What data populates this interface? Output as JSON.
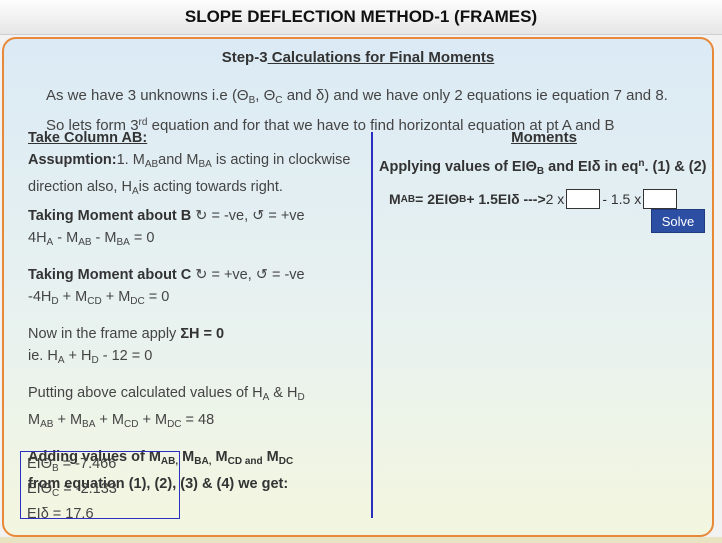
{
  "header": {
    "title": "SLOPE DEFLECTION METHOD-1 (FRAMES)"
  },
  "step": {
    "prefix": "Step-3",
    "title": " Calculations for Final Moments"
  },
  "intro": {
    "l1a": "As we have 3 unknowns i.e (Θ",
    "l1b": "B",
    "l1c": ", Θ",
    "l1d": "C",
    "l1e": " and δ) and we have only 2 equations ie equation 7 and 8.",
    "l2a": "So lets form 3",
    "l2b": "rd",
    "l2c": " equation and for that we have to find horizontal equation at pt A and B"
  },
  "left": {
    "column_title": "Take Column AB:",
    "assump_label": "Assupmtion:",
    "assump_a": "1. M",
    "assump_b": "AB",
    "assump_c": "and M",
    "assump_d": "BA",
    "assump_e": " is acting in clockwise",
    "assump2_a": "direction also, H",
    "assump2_b": "A",
    "assump2_c": "is acting towards right.",
    "tmB_label": "Taking Moment about B",
    "tmB_signs": " ↻ = -ve, ↺ = +ve",
    "eqB_a": "4H",
    "eqB_b": "A",
    "eqB_c": " - M",
    "eqB_d": "AB",
    "eqB_e": " - M",
    "eqB_f": "BA",
    "eqB_g": " = 0",
    "tmC_label": "Taking Moment about C",
    "tmC_signs": " ↻ = +ve, ↺ = -ve",
    "eqC_a": "-4H",
    "eqC_b": "D",
    "eqC_c": " + M",
    "eqC_d": "CD",
    "eqC_e": " + M",
    "eqC_f": "DC",
    "eqC_g": " = 0",
    "frame_a": "Now in the frame apply ",
    "frame_b": "ΣH = 0",
    "ie_a": "ie. H",
    "ie_b": "A",
    "ie_c": " + H",
    "ie_d": "D",
    "ie_e": " - 12 = 0",
    "put_a": "Putting above calculated values of H",
    "put_b": "A",
    "put_c": " & H",
    "put_d": "D",
    "sum_a": "M",
    "sum_b": "AB",
    "sum_c": " + M",
    "sum_d": "BA",
    "sum_e": " + M",
    "sum_f": "CD",
    "sum_g": " + M",
    "sum_h": "DC",
    "sum_i": " = 48",
    "add_a": "Adding values of M",
    "add_b": "AB,",
    "add_c": " M",
    "add_d": "BA,",
    "add_e": " M",
    "add_f": "CD and",
    "add_g": " M",
    "add_h": "DC",
    "from": "from equation (1), (2), (3) & (4) we get:",
    "res1_a": "EIΘ",
    "res1_b": "B",
    "res1_c": " = -7.466",
    "res2_a": "EIΘ",
    "res2_b": "C",
    "res2_c": " = -2.133",
    "res3": "EIδ = 17.6"
  },
  "right": {
    "moments_title": "Moments",
    "apply_a": "Applying values of EIΘ",
    "apply_b": "B",
    "apply_c": " and EIδ in eq",
    "apply_d": "n",
    "apply_e": ". (1) & (2)",
    "mab_a": "M",
    "mab_b": "AB",
    "mab_c": " = 2EIΘ",
    "mab_d": "B",
    "mab_e": " + 1.5EIδ --->",
    "mab_f": " 2 x",
    "mab_g": "- 1.5 x",
    "input1_value": "",
    "input2_value": "",
    "solve_label": "Solve"
  }
}
